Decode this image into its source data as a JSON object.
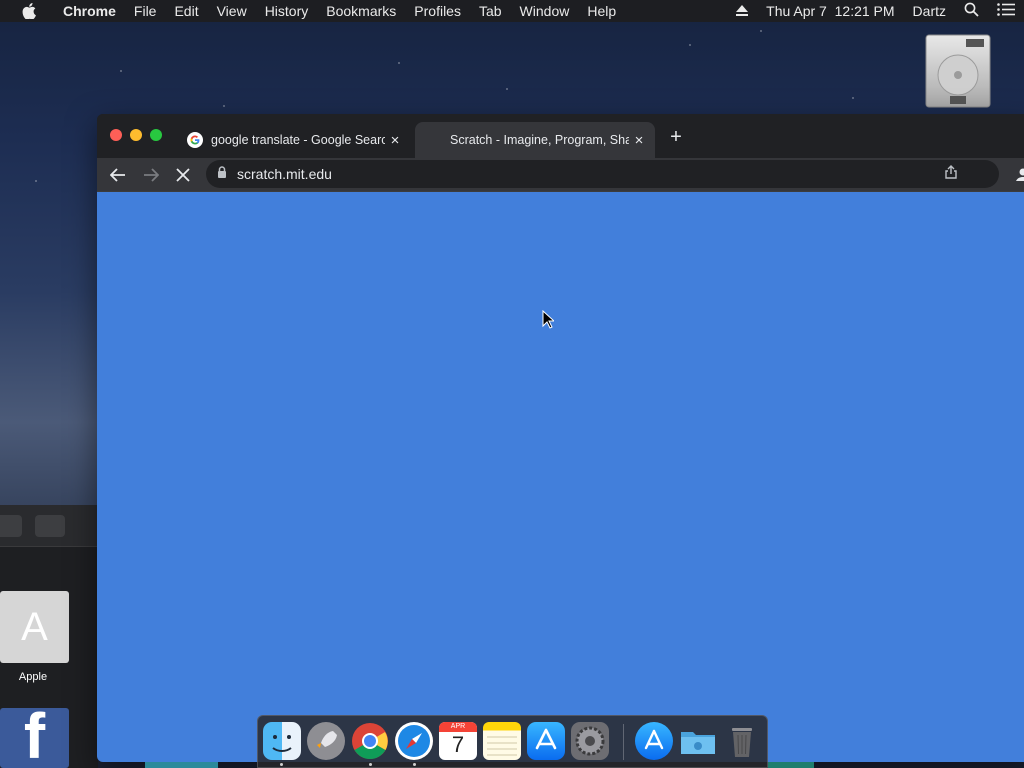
{
  "menubar": {
    "app_name": "Chrome",
    "items": [
      "File",
      "Edit",
      "View",
      "History",
      "Bookmarks",
      "Profiles",
      "Tab",
      "Window",
      "Help"
    ],
    "datetime": "Thu Apr 7  12:21 PM",
    "user": "Dartz"
  },
  "desktop": {
    "app_tiles": [
      {
        "label": "Apple",
        "glyph": "A"
      },
      {
        "label": "",
        "glyph": "f"
      }
    ]
  },
  "browser": {
    "tabs": [
      {
        "title": "google translate - Google Search",
        "favicon": "google-g-icon",
        "active": false
      },
      {
        "title": "Scratch - Imagine, Program, Share",
        "favicon": "none",
        "active": true
      }
    ],
    "new_tab_label": "+",
    "tab_close_label": "×",
    "url": "scratch.mit.edu",
    "content_color": "#427fdb",
    "loading": true
  },
  "dock": {
    "apps": [
      "Finder",
      "Launchpad",
      "Google Chrome",
      "Safari",
      "Calendar",
      "Notes",
      "App Store",
      "System Preferences",
      "App Store Downloads",
      "Downloads Folder",
      "Trash"
    ],
    "calendar_month": "APR",
    "calendar_day": "7"
  }
}
